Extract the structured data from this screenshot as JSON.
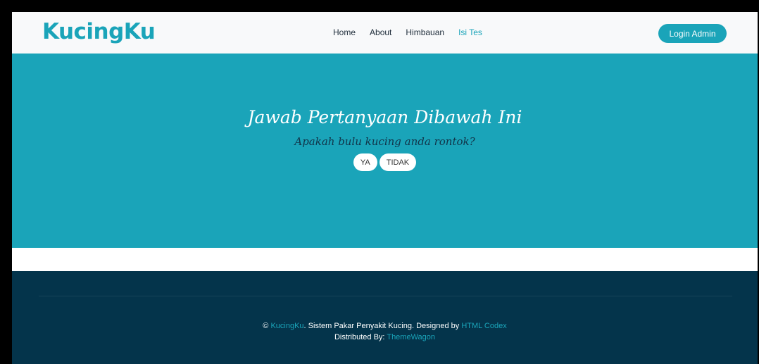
{
  "navbar": {
    "brand": "KucingKu",
    "links": [
      {
        "label": "Home"
      },
      {
        "label": "About"
      },
      {
        "label": "Himbauan"
      },
      {
        "label": "Isi Tes"
      }
    ],
    "login_label": "Login Admin"
  },
  "hero": {
    "title": "Jawab Pertanyaan Dibawah Ini",
    "question": "Apakah bulu kucing anda rontok?",
    "answers": {
      "yes": "YA",
      "no": "TIDAK"
    }
  },
  "footer": {
    "copyright_symbol": "©",
    "brand_link": "KucingKu",
    "line1_text": ". Sistem Pakar Penyakit Kucing. Designed by ",
    "designer_link": "HTML Codex",
    "distributed_label": "Distributed By: ",
    "distributor_link": "ThemeWagon"
  },
  "colors": {
    "accent": "#1aa4b9",
    "footer_bg": "#04344b",
    "navbar_bg": "#f8f9fa"
  }
}
